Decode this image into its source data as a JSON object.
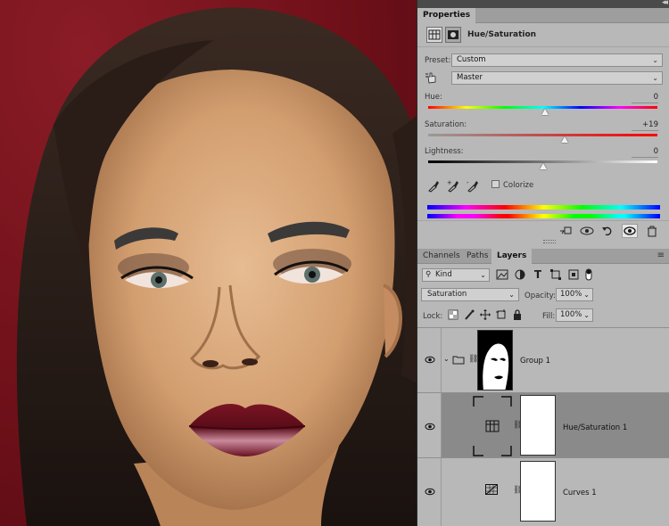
{
  "properties": {
    "tab_label": "Properties",
    "title": "Hue/Saturation",
    "preset_label": "Preset:",
    "preset_value": "Custom",
    "channel_value": "Master",
    "hue_label": "Hue:",
    "hue_value": "0",
    "hue_level": 0.51,
    "saturation_label": "Saturation:",
    "saturation_value": "+19",
    "saturation_level": 0.595,
    "lightness_label": "Lightness:",
    "lightness_value": "0",
    "lightness_level": 0.5,
    "colorize_label": "Colorize",
    "colorize_checked": false
  },
  "layers_panel": {
    "tabs": [
      "Channels",
      "Paths",
      "Layers"
    ],
    "active_tab": "Layers",
    "filter_kind": "Kind",
    "blend_mode": "Saturation",
    "opacity_label": "Opacity:",
    "opacity_value": "100%",
    "lock_label": "Lock:",
    "fill_label": "Fill:",
    "fill_value": "100%",
    "layers": [
      {
        "name": "Group 1",
        "type": "group",
        "visible": true,
        "selected": false
      },
      {
        "name": "Hue/Saturation 1",
        "type": "adjustment",
        "visible": true,
        "selected": true
      },
      {
        "name": "Curves 1",
        "type": "adjustment",
        "visible": true,
        "selected": false
      }
    ]
  },
  "colors": {
    "panel_bg": "#b8b8b8",
    "selected_layer": "#8a8a8a",
    "backdrop_red": "#6f1019"
  }
}
